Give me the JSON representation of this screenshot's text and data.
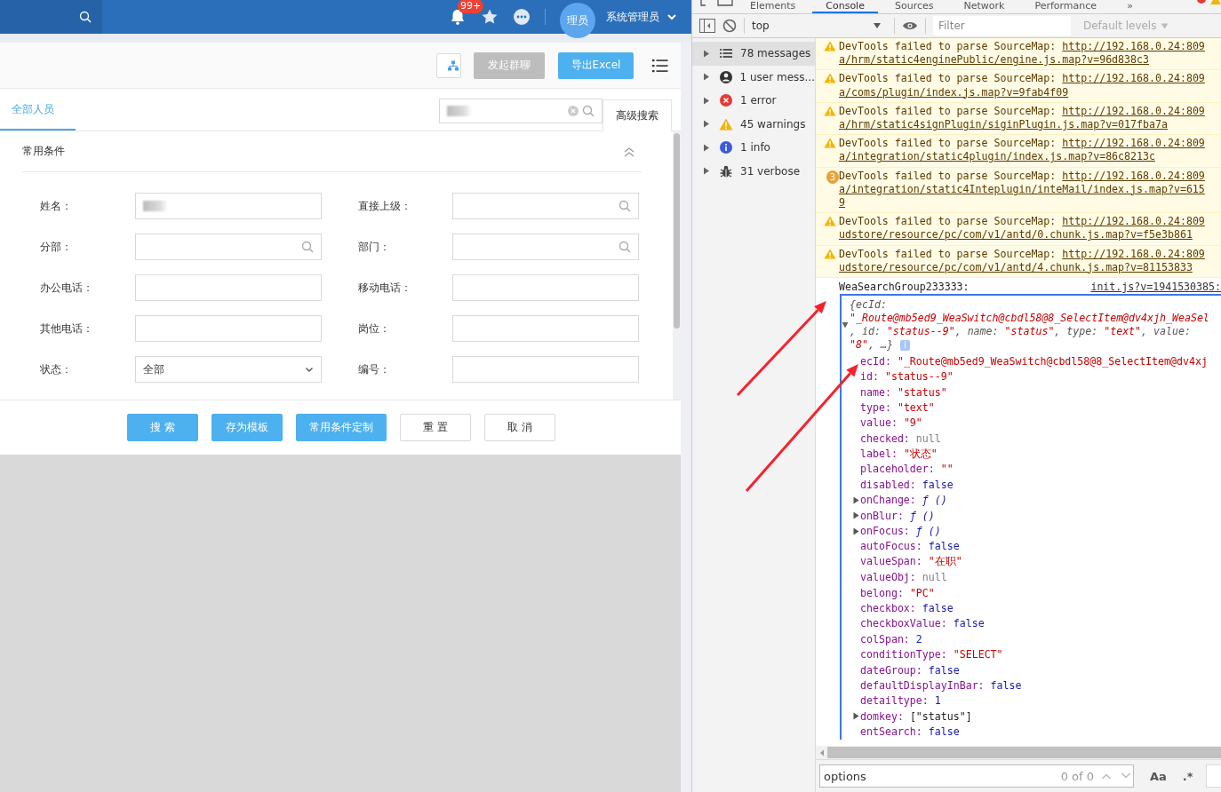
{
  "app": {
    "topbar": {
      "notification_count": "99+",
      "avatar": "理员",
      "user_name": "系统管理员"
    },
    "toolbar": {
      "buttons": [
        {
          "label": "发起群聊",
          "disabled": true
        },
        {
          "label": "导出Excel",
          "disabled": false
        }
      ]
    },
    "tabs": [
      {
        "label": "全部人员",
        "selected": true
      }
    ],
    "quick_search": {
      "redacted": true
    },
    "advanced_search": "高级搜索",
    "section_title": "常用条件",
    "fields": [
      {
        "label": "姓名：",
        "kind": "text",
        "redacted": true
      },
      {
        "label": "直接上级：",
        "kind": "lookup"
      },
      {
        "label": "分部：",
        "kind": "lookup"
      },
      {
        "label": "部门：",
        "kind": "lookup"
      },
      {
        "label": "办公电话：",
        "kind": "text",
        "redacted": false
      },
      {
        "label": "移动电话：",
        "kind": "text",
        "redacted": false
      },
      {
        "label": "其他电话：",
        "kind": "text",
        "redacted": false
      },
      {
        "label": "岗位：",
        "kind": "text",
        "redacted": false
      },
      {
        "label": "状态：",
        "kind": "select",
        "value": "全部"
      },
      {
        "label": "编号：",
        "kind": "text",
        "redacted": false
      }
    ],
    "actions": [
      {
        "label": "搜 索",
        "primary": true
      },
      {
        "label": "存为模板",
        "primary": true
      },
      {
        "label": "常用条件定制",
        "primary": true
      },
      {
        "label": "重 置",
        "primary": false
      },
      {
        "label": "取 消",
        "primary": false
      }
    ]
  },
  "devtools": {
    "tabs": [
      {
        "label": "Elements",
        "selected": false
      },
      {
        "label": "Console",
        "selected": true
      },
      {
        "label": "Sources",
        "selected": false
      },
      {
        "label": "Network",
        "selected": false
      },
      {
        "label": "Performance",
        "selected": false
      },
      {
        "label": "»",
        "selected": false
      }
    ],
    "context": "top",
    "filter_placeholder": "Filter",
    "levels": "Default levels",
    "sidebar": [
      {
        "label": "78 messages",
        "kind": "list",
        "selected": true
      },
      {
        "label": "1 user mess...",
        "kind": "user",
        "selected": false
      },
      {
        "label": "1 error",
        "kind": "error",
        "selected": false
      },
      {
        "label": "45 warnings",
        "kind": "warning",
        "selected": false
      },
      {
        "label": "1 info",
        "kind": "info",
        "selected": false
      },
      {
        "label": "31 verbose",
        "kind": "verbose",
        "selected": false
      }
    ],
    "messages": [
      {
        "kind": "warning",
        "text": "DevTools failed to parse SourceMap:",
        "link": [
          "http://192.168.0.24:809",
          "a/hrm/static4enginePublic/engine.js.map?v=96d838c3"
        ]
      },
      {
        "kind": "warning",
        "text": "DevTools failed to parse SourceMap:",
        "link": [
          "http://192.168.0.24:809",
          "a/coms/plugin/index.js.map?v=9fab4f09"
        ]
      },
      {
        "kind": "warning",
        "text": "DevTools failed to parse SourceMap:",
        "link": [
          "http://192.168.0.24:809",
          "a/hrm/static4signPlugin/siginPlugin.js.map?v=017fba7a"
        ]
      },
      {
        "kind": "warning",
        "text": "DevTools failed to parse SourceMap:",
        "link": [
          "http://192.168.0.24:809",
          "a/integration/static4plugin/index.js.map?v=86c8213c"
        ]
      },
      {
        "kind": "repeated",
        "count": "3",
        "text": "DevTools failed to parse SourceMap:",
        "link": [
          "http://192.168.0.24:809",
          "a/integration/static4Inteplugin/inteMail/index.js.map?v=615",
          "9"
        ]
      },
      {
        "kind": "warning",
        "text": "DevTools failed to parse SourceMap:",
        "link": [
          "http://192.168.0.24:809",
          "udstore/resource/pc/com/v1/antd/0.chunk.js.map?v=f5e3b861"
        ]
      },
      {
        "kind": "warning",
        "text": "DevTools failed to parse SourceMap:",
        "link": [
          "http://192.168.0.24:809",
          "udstore/resource/pc/com/v1/antd/4.chunk.js.map?v=81153833"
        ]
      }
    ],
    "log": {
      "text": "WeaSearchGroup233333:",
      "source": "init.js?v=1941530385:"
    },
    "object": {
      "expanded": true,
      "info": "i",
      "preview": [
        [
          {
            "text": "{ecId:",
            "kind": "plain"
          }
        ],
        [
          {
            "text": "\"_Route@mb5ed9_WeaSwitch@cbdl58@8_SelectItem@dv4xjh_WeaSel",
            "kind": "string"
          }
        ],
        [
          {
            "text": ", id: ",
            "kind": "plain"
          },
          {
            "text": "\"status--9\"",
            "kind": "string"
          },
          {
            "text": ", name: ",
            "kind": "plain"
          },
          {
            "text": "\"status\"",
            "kind": "string"
          },
          {
            "text": ", type: ",
            "kind": "plain"
          },
          {
            "text": "\"text\"",
            "kind": "string"
          },
          {
            "text": ", value:",
            "kind": "plain"
          }
        ],
        [
          {
            "text": "\"8\"",
            "kind": "string"
          },
          {
            "text": ", …}",
            "kind": "plain"
          }
        ]
      ],
      "properties": [
        {
          "key": "ecId:",
          "value": "\"_Route@mb5ed9_WeaSwitch@cbdl58@8_SelectItem@dv4xj",
          "kind": "string",
          "expandable": false
        },
        {
          "key": "id:",
          "value": "\"status--9\"",
          "kind": "string",
          "expandable": false
        },
        {
          "key": "name:",
          "value": "\"status\"",
          "kind": "string",
          "expandable": false
        },
        {
          "key": "type:",
          "value": "\"text\"",
          "kind": "string",
          "expandable": false
        },
        {
          "key": "value:",
          "value": "\"9\"",
          "kind": "string",
          "expandable": false
        },
        {
          "key": "checked:",
          "value": "null",
          "kind": "null",
          "expandable": false
        },
        {
          "key": "label:",
          "value": "\"状态\"",
          "kind": "string",
          "expandable": false
        },
        {
          "key": "placeholder:",
          "value": "\"\"",
          "kind": "string",
          "expandable": false
        },
        {
          "key": "disabled:",
          "value": "false",
          "kind": "keyword",
          "expandable": false
        },
        {
          "key": "onChange:",
          "value": "ƒ ()",
          "kind": "function",
          "expandable": true
        },
        {
          "key": "onBlur:",
          "value": "ƒ ()",
          "kind": "function",
          "expandable": true
        },
        {
          "key": "onFocus:",
          "value": "ƒ ()",
          "kind": "function",
          "expandable": true
        },
        {
          "key": "autoFocus:",
          "value": "false",
          "kind": "keyword",
          "expandable": false
        },
        {
          "key": "valueSpan:",
          "value": "\"在职\"",
          "kind": "string",
          "expandable": false
        },
        {
          "key": "valueObj:",
          "value": "null",
          "kind": "null",
          "expandable": false
        },
        {
          "key": "belong:",
          "value": "\"PC\"",
          "kind": "string",
          "expandable": false
        },
        {
          "key": "checkbox:",
          "value": "false",
          "kind": "keyword",
          "expandable": false
        },
        {
          "key": "checkboxValue:",
          "value": "false",
          "kind": "keyword",
          "expandable": false
        },
        {
          "key": "colSpan:",
          "value": "2",
          "kind": "keyword",
          "expandable": false
        },
        {
          "key": "conditionType:",
          "value": "\"SELECT\"",
          "kind": "string",
          "expandable": false
        },
        {
          "key": "dateGroup:",
          "value": "false",
          "kind": "keyword",
          "expandable": false
        },
        {
          "key": "defaultDisplayInBar:",
          "value": "false",
          "kind": "keyword",
          "expandable": false
        },
        {
          "key": "detailtype:",
          "value": "1",
          "kind": "keyword",
          "expandable": false
        },
        {
          "key": "domkey:",
          "value": "[\"status\"]",
          "kind": "array",
          "expandable": true
        },
        {
          "key": "entSearch:",
          "value": "false",
          "kind": "keyword",
          "expandable": false
        }
      ]
    },
    "find": {
      "value": "options",
      "count": "0 of 0",
      "case_label": "Aa",
      "regex_label": ".*"
    }
  }
}
